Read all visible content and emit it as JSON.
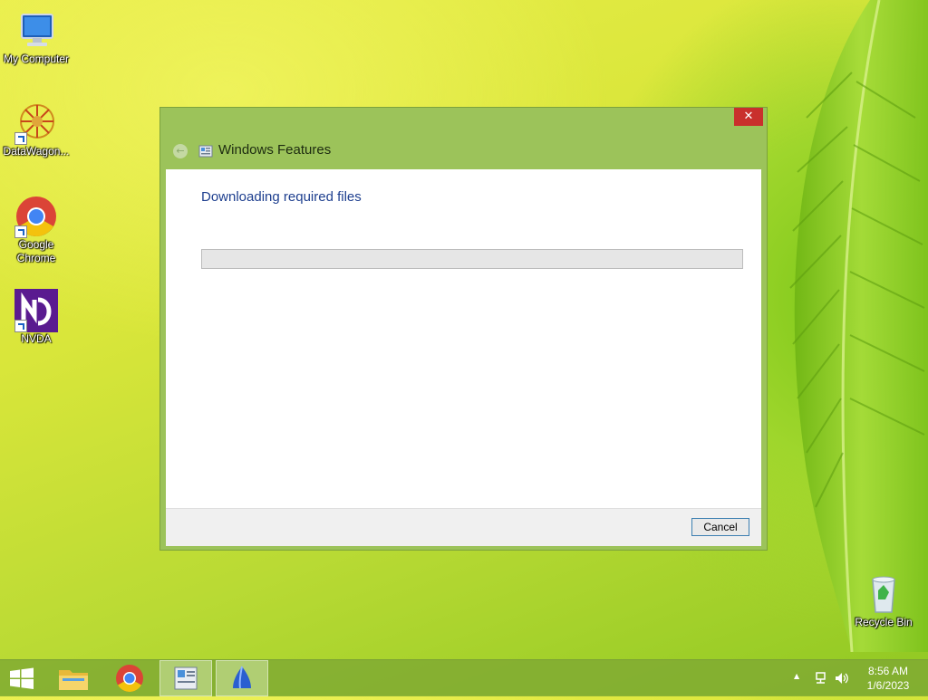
{
  "desktop": {
    "icons": [
      {
        "label": "My Computer"
      },
      {
        "label": "DataWagon..."
      },
      {
        "label_line1": "Google",
        "label_line2": "Chrome"
      },
      {
        "label": "NVDA"
      }
    ],
    "recycle_bin": {
      "label": "Recycle Bin"
    }
  },
  "dialog": {
    "title": "Windows Features",
    "close_glyph": "✕",
    "back_glyph": "←",
    "heading": "Downloading required files",
    "progress_fraction": 0,
    "cancel_label": "Cancel"
  },
  "taskbar": {
    "items": [
      {
        "icon": "windows-start-icon"
      },
      {
        "icon": "file-explorer-icon"
      },
      {
        "icon": "chrome-icon"
      },
      {
        "icon": "windows-features-icon",
        "active": true
      },
      {
        "icon": "nvda-icon",
        "active": true
      }
    ],
    "tray": {
      "chevron": "▲",
      "time": "8:56 AM",
      "date": "1/6/2023"
    }
  },
  "colors": {
    "dialog_frame": "#9cc35a",
    "heading": "#1e3f8f",
    "close_button": "#c9302c"
  }
}
